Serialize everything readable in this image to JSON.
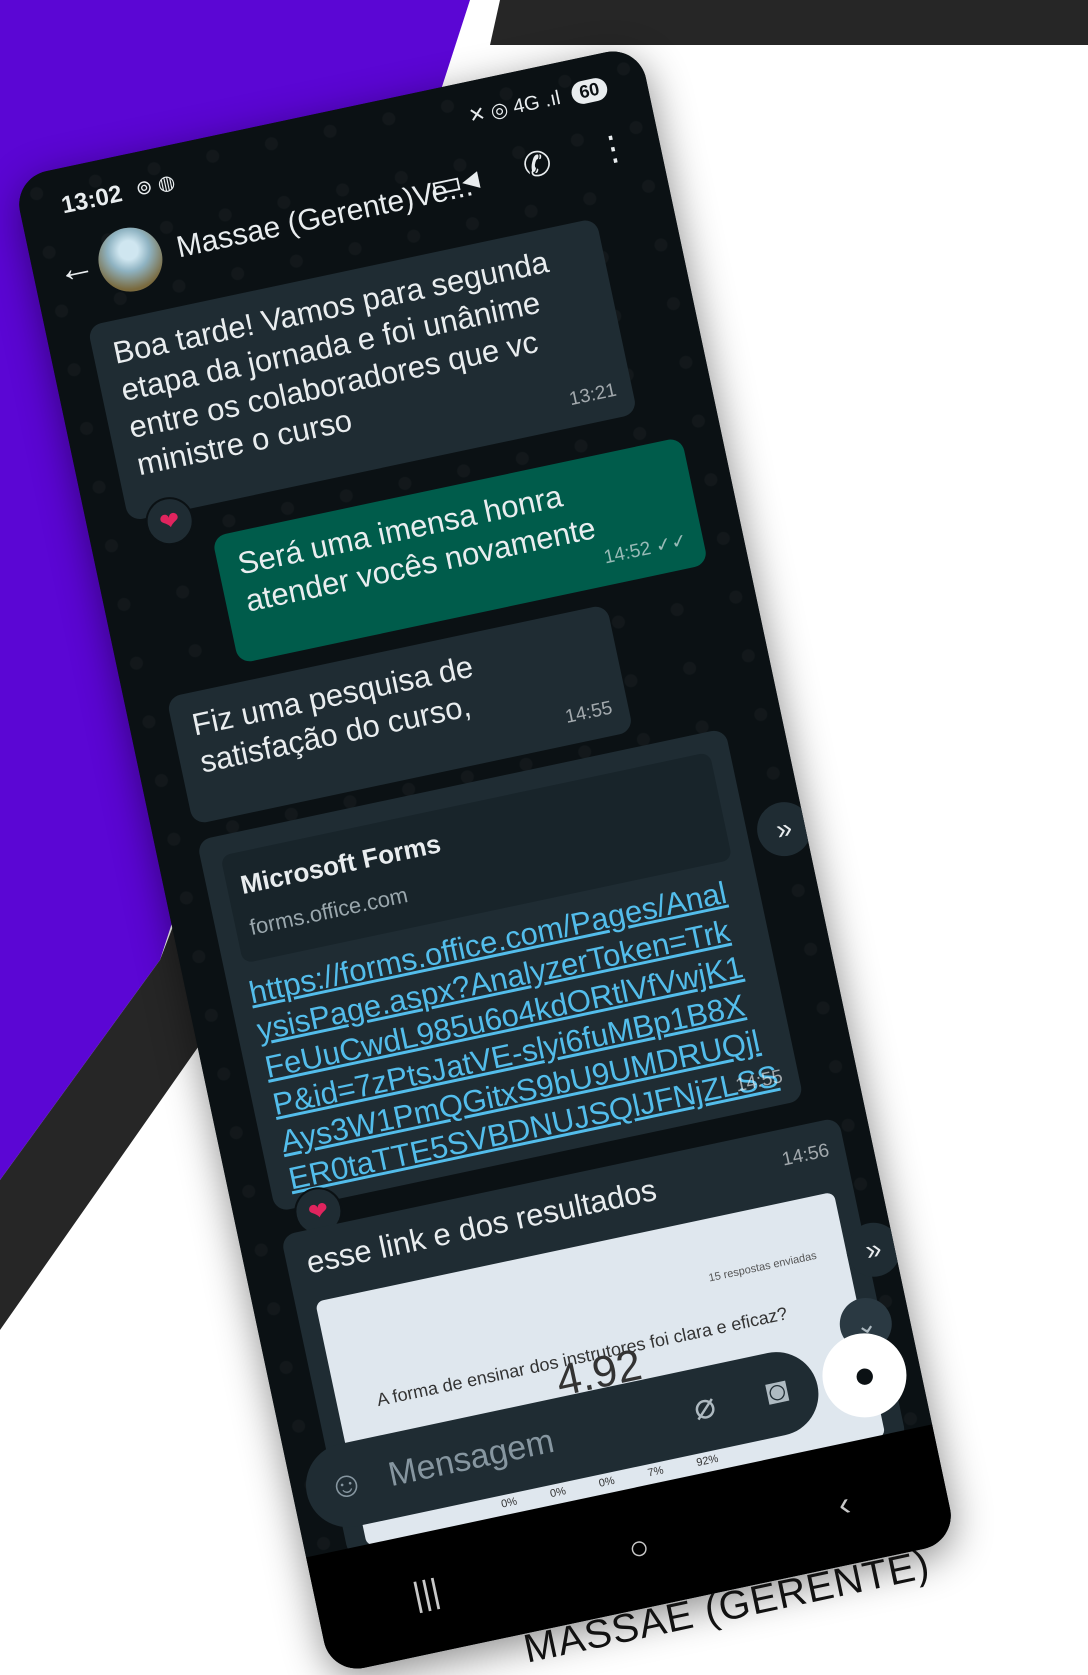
{
  "status_bar": {
    "time": "13:02",
    "left_icons": "⊚ ◍",
    "right_icons": "✕ ◎ 4G .ıl",
    "battery": "60"
  },
  "header": {
    "contact": "Massae (Gerente)Ve..."
  },
  "messages": [
    {
      "text": "Boa tarde! Vamos para segunda etapa da jornada e foi unânime entre os colaboradores que vc ministre o curso",
      "time": "13:21"
    },
    {
      "text": "Será uma imensa honra atender vocês novamente",
      "time": "14:52 ✓✓"
    },
    {
      "text": "Fiz uma pesquisa de satisfação do curso,",
      "time": "14:55"
    },
    {
      "link_title": "Microsoft Forms",
      "link_domain": "forms.office.com",
      "url": "https://forms.office.com/Pages/AnalysisPage.aspx?AnalyzerToken=TrkFeUuCwdL985u6o4kdORtlVfVwjK1P&id=7zPtsJatVE-slyi6fuMBp1B8XAys3W1PmQGitxS9bU9UMDRUQjlER0taTTE5SVBDNUJSQlJFNjZLSS4u",
      "time": "14:55"
    },
    {
      "text": "esse link e dos resultados",
      "time": "14:56"
    }
  ],
  "image_preview": {
    "count": "15 respostas enviadas",
    "question": "A forma de ensinar dos instrutores foi clara e eficaz?",
    "score": "4.92",
    "pcts": [
      "0%",
      "0%",
      "0%",
      "7%",
      "92%"
    ]
  },
  "composer": {
    "placeholder": "Mensagem"
  },
  "caption": "MASSAE (GERENTE)",
  "colors": {
    "purple": "#5b06d4",
    "dark": "#262626",
    "out_bubble": "#005c4b",
    "in_bubble": "#1f2c33"
  }
}
